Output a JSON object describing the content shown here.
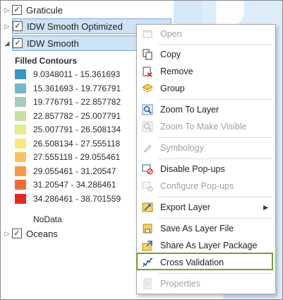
{
  "layers": {
    "graticule": {
      "label": "Graticule"
    },
    "idw_optimized": {
      "label": "IDW Smooth Optimized"
    },
    "idw_smooth": {
      "label": "IDW Smooth"
    },
    "oceans": {
      "label": "Oceans"
    }
  },
  "legend": {
    "title": "Filled Contours",
    "items": [
      {
        "range": "9.0348011 - 15.361693",
        "color": "#3a95c8"
      },
      {
        "range": "15.361693 - 19.776791",
        "color": "#76b6c9"
      },
      {
        "range": "19.776791 - 22.857782",
        "color": "#a8cbb8"
      },
      {
        "range": "22.857782 - 25.007791",
        "color": "#c9dfa3"
      },
      {
        "range": "25.007791 - 26.508134",
        "color": "#e2ec8c"
      },
      {
        "range": "26.508134 - 27.555118",
        "color": "#f7e979"
      },
      {
        "range": "27.555118 - 29.055461",
        "color": "#fac35f"
      },
      {
        "range": "29.055461 - 31.20547",
        "color": "#f79a47"
      },
      {
        "range": "31.20547 - 34.286461",
        "color": "#ef6a33"
      },
      {
        "range": "34.286461 - 38.701559",
        "color": "#e6291f"
      }
    ],
    "nodata": "NoData"
  },
  "menu": {
    "open": "Open",
    "copy": "Copy",
    "remove": "Remove",
    "group": "Group",
    "zoom_to_layer": "Zoom To Layer",
    "zoom_visible": "Zoom To Make Visible",
    "symbology": "Symbology",
    "disable_popups": "Disable Pop-ups",
    "configure_popups": "Configure Pop-ups",
    "export_layer": "Export Layer",
    "save_layer_file": "Save As Layer File",
    "share_package": "Share As Layer Package",
    "cross_validation": "Cross Validation",
    "properties": "Properties"
  },
  "icons": {
    "check": "checkmark",
    "expand_right": "triangle-right",
    "expand_down": "triangle-down",
    "accent": "#6fa134"
  }
}
